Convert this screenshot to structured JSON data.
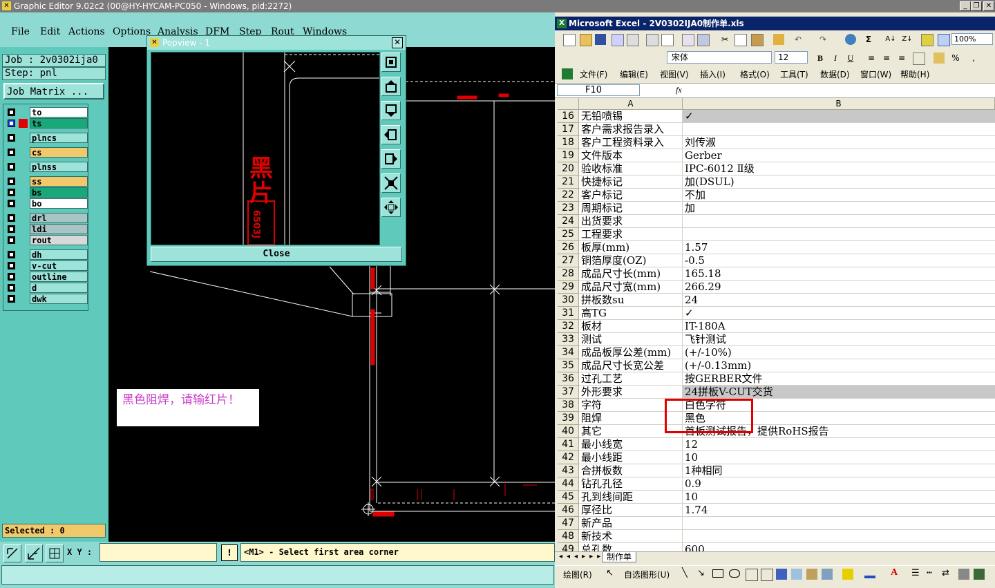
{
  "genesis": {
    "title": "Graphic Editor 9.02c2 (00@HY-HYCAM-PC050 - Windows, pid:2272)",
    "menu": [
      "File",
      "Edit",
      "Actions",
      "Options",
      "Analysis",
      "DFM",
      "Step",
      "Rout",
      "Windows"
    ],
    "job_label": "Job : 2v0302ija0",
    "step_label": "Step: pnl",
    "job_matrix_label": "Job Matrix ...",
    "layers": [
      {
        "name": "to",
        "color": "#ffffff"
      },
      {
        "name": "ts",
        "color": "#19a878"
      },
      {
        "name": "plncs",
        "color": "#9ee3da"
      },
      {
        "name": "cs",
        "color": "#f2c96a"
      },
      {
        "name": "plnss",
        "color": "#9ee3da"
      },
      {
        "name": "ss",
        "color": "#f2c96a"
      },
      {
        "name": "bs",
        "color": "#19a878"
      },
      {
        "name": "bo",
        "color": "#ffffff"
      },
      {
        "name": "drl",
        "color": "#a8c4c4"
      },
      {
        "name": "ldi",
        "color": "#a8c4c4"
      },
      {
        "name": "rout",
        "color": "#d8d8d8"
      },
      {
        "name": "dh",
        "color": "#9ee3da"
      },
      {
        "name": "v-cut",
        "color": "#9ee3da"
      },
      {
        "name": "outline",
        "color": "#9ee3da"
      },
      {
        "name": "d",
        "color": "#9ee3da"
      },
      {
        "name": "dwk",
        "color": "#9ee3da"
      }
    ],
    "selected_label": "Selected : 0",
    "xy_label": "X Y :",
    "xy_value": "",
    "status_message": "<M1> - Select first area corner",
    "note_text": "黑色阻焊，请输红片！",
    "popview": {
      "title": "Popview - 1",
      "close_label": "Close",
      "film_text": "黑片",
      "film_code": "6503J"
    }
  },
  "excel": {
    "title": "Microsoft Excel - 2V0302IJA0制作单.xls",
    "font_name": "宋体",
    "font_size": "12",
    "zoom": "100%",
    "menu": [
      "文件(F)",
      "编辑(E)",
      "视图(V)",
      "插入(I)",
      "格式(O)",
      "工具(T)",
      "数据(D)",
      "窗口(W)",
      "帮助(H)"
    ],
    "name_box": "F10",
    "formula_icon": "fx",
    "col_a": "A",
    "col_b": "B",
    "rows": [
      {
        "n": "16",
        "a": "无铅喷锡",
        "b": "✓"
      },
      {
        "n": "17",
        "a": "客户需求报告录入",
        "b": ""
      },
      {
        "n": "18",
        "a": "客户工程资料录入",
        "b": "刘传淑"
      },
      {
        "n": "19",
        "a": "文件版本",
        "b": "Gerber"
      },
      {
        "n": "20",
        "a": "验收标准",
        "b": "IPC-6012 Ⅱ级"
      },
      {
        "n": "21",
        "a": "快捷标记",
        "b": "加(DSUL)"
      },
      {
        "n": "22",
        "a": "客户标记",
        "b": "不加"
      },
      {
        "n": "23",
        "a": "周期标记",
        "b": "加"
      },
      {
        "n": "24",
        "a": "出货要求",
        "b": ""
      },
      {
        "n": "25",
        "a": "工程要求",
        "b": ""
      },
      {
        "n": "26",
        "a": "板厚(mm)",
        "b": "1.57"
      },
      {
        "n": "27",
        "a": "铜箔厚度(OZ)",
        "b": "-0.5"
      },
      {
        "n": "28",
        "a": "成品尺寸长(mm)",
        "b": "165.18"
      },
      {
        "n": "29",
        "a": "成品尺寸宽(mm)",
        "b": "266.29"
      },
      {
        "n": "30",
        "a": "拼板数su",
        "b": "24"
      },
      {
        "n": "31",
        "a": "高TG",
        "b": "✓"
      },
      {
        "n": "32",
        "a": "板材",
        "b": "IT-180A"
      },
      {
        "n": "33",
        "a": "测试",
        "b": "飞针测试"
      },
      {
        "n": "34",
        "a": "成品板厚公差(mm)",
        "b": "(+/-10%)"
      },
      {
        "n": "35",
        "a": "成品尺寸长宽公差",
        "b": "(+/-0.13mm)"
      },
      {
        "n": "36",
        "a": "过孔工艺",
        "b": "按GERBER文件"
      },
      {
        "n": "37",
        "a": "外形要求",
        "b": "24拼板V-CUT交货"
      },
      {
        "n": "38",
        "a": "字符",
        "b": "白色字符"
      },
      {
        "n": "39",
        "a": "阻焊",
        "b": "黑色"
      },
      {
        "n": "40",
        "a": "其它",
        "b": "首板测试报告，提供RoHS报告"
      },
      {
        "n": "41",
        "a": "最小线宽",
        "b": "12"
      },
      {
        "n": "42",
        "a": "最小线距",
        "b": "10"
      },
      {
        "n": "43",
        "a": "合拼板数",
        "b": "1种相同"
      },
      {
        "n": "44",
        "a": "钻孔孔径",
        "b": "0.9"
      },
      {
        "n": "45",
        "a": "孔到线间距",
        "b": "10"
      },
      {
        "n": "46",
        "a": "厚径比",
        "b": "1.74"
      },
      {
        "n": "47",
        "a": "新产品",
        "b": ""
      },
      {
        "n": "48",
        "a": "新技术",
        "b": ""
      },
      {
        "n": "49",
        "a": "总孔数",
        "b": "600"
      }
    ],
    "sheet_tab": "制作单",
    "draw_label": "绘图(R)",
    "autoshape_label": "自选图形(U)"
  }
}
